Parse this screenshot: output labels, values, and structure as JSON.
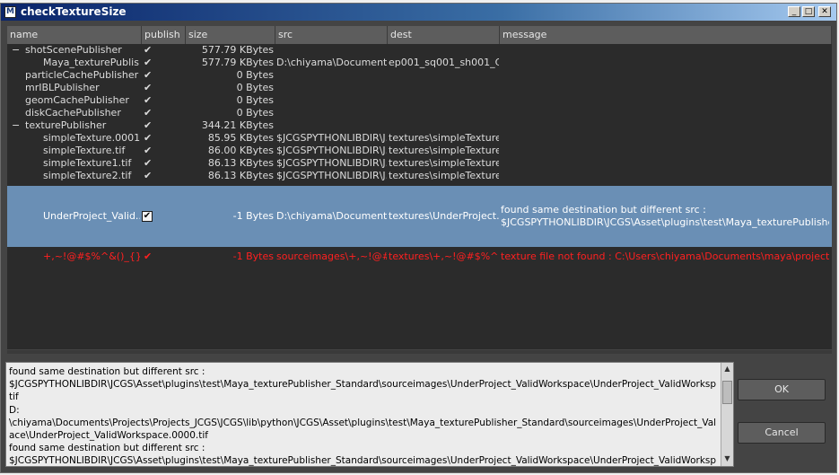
{
  "window": {
    "title": "checkTextureSize",
    "minimize": "_",
    "maximize": "□",
    "close": "✕"
  },
  "columns": [
    "name",
    "publish",
    "size",
    "src",
    "dest",
    "message"
  ],
  "rows": [
    {
      "expander": "−",
      "name": "shotScenePublisher",
      "publish": "✔",
      "size": "577.79 KBytes",
      "src": "",
      "dest": "",
      "message": ""
    },
    {
      "expander": "",
      "name": "Maya_texturePublis...",
      "publish": "✔",
      "size": "577.79 KBytes",
      "src": "D:\\chiyama\\Documents...",
      "dest": "ep001_sq001_sh001_C...",
      "message": ""
    },
    {
      "expander": "",
      "name": "particleCachePublisher",
      "publish": "✔",
      "size": "0 Bytes",
      "src": "",
      "dest": "",
      "message": ""
    },
    {
      "expander": "",
      "name": "mrIBLPublisher",
      "publish": "✔",
      "size": "0 Bytes",
      "src": "",
      "dest": "",
      "message": ""
    },
    {
      "expander": "",
      "name": "geomCachePublisher",
      "publish": "✔",
      "size": "0 Bytes",
      "src": "",
      "dest": "",
      "message": ""
    },
    {
      "expander": "",
      "name": "diskCachePublisher",
      "publish": "✔",
      "size": "0 Bytes",
      "src": "",
      "dest": "",
      "message": ""
    },
    {
      "expander": "−",
      "name": "texturePublisher",
      "publish": "✔",
      "size": "344.21 KBytes",
      "src": "",
      "dest": "",
      "message": ""
    },
    {
      "expander": "",
      "name": "simpleTexture.0001.tif",
      "publish": "✔",
      "size": "85.95 KBytes",
      "src": "$JCGSPYTHONLIBDIR\\J...",
      "dest": "textures\\simpleTexture...",
      "message": ""
    },
    {
      "expander": "",
      "name": "simpleTexture.tif",
      "publish": "✔",
      "size": "86.00 KBytes",
      "src": "$JCGSPYTHONLIBDIR\\J...",
      "dest": "textures\\simpleTexture...",
      "message": ""
    },
    {
      "expander": "",
      "name": "simpleTexture1.tif",
      "publish": "✔",
      "size": "86.13 KBytes",
      "src": "$JCGSPYTHONLIBDIR\\J...",
      "dest": "textures\\simpleTexture...",
      "message": ""
    },
    {
      "expander": "",
      "name": "simpleTexture2.tif",
      "publish": "✔",
      "size": "86.13 KBytes",
      "src": "$JCGSPYTHONLIBDIR\\J...",
      "dest": "textures\\simpleTexture...",
      "message": ""
    },
    {
      "expander": "",
      "name": "UnderProject_Valid...",
      "publish": "✔",
      "size": "-1 Bytes",
      "src": "D:\\chiyama\\Documents...",
      "dest": "textures\\UnderProject...",
      "message": "found same destination but different src :",
      "message2": "$JCGSPYTHONLIBDIR\\JCGS\\Asset\\plugins\\test\\Maya_texturePublisher_St..."
    },
    {
      "expander": "",
      "name": "+,~!@#$%^&()_{}...",
      "publish": "✔",
      "size": "-1 Bytes",
      "src": "sourceimages\\+,~!@#...",
      "dest": "textures\\+,~!@#$%^...",
      "message": "texture file not found : C:\\Users\\chiyama\\Documents\\maya\\projects\\defa..."
    }
  ],
  "log": {
    "lines": [
      "found same destination but different src :",
      "$JCGSPYTHONLIBDIR\\JCGS\\Asset\\plugins\\test\\Maya_texturePublisher_Standard\\sourceimages\\UnderProject_ValidWorkspace\\UnderProject_ValidWorkspace.0000.",
      "tif",
      "D:",
      "\\chiyama\\Documents\\Projects\\Projects_JCGS\\JCGS\\lib\\python\\JCGS\\Asset\\plugins\\test\\Maya_texturePublisher_Standard\\sourceimages\\UnderProject_ValidWorksp",
      "ace\\UnderProject_ValidWorkspace.0000.tif",
      "found same destination but different src :",
      "$JCGSPYTHONLIBDIR\\JCGS\\Asset\\plugins\\test\\Maya_texturePublisher_Standard\\sourceimages\\UnderProject_ValidWorkspace\\UnderProject_ValidWorkspace.0000."
    ]
  },
  "buttons": {
    "ok": "OK",
    "cancel": "Cancel"
  },
  "colors": {
    "selected_row": "#6a8fb5",
    "error_text": "#ff2020",
    "panel_bg": "#2b2b2b"
  }
}
